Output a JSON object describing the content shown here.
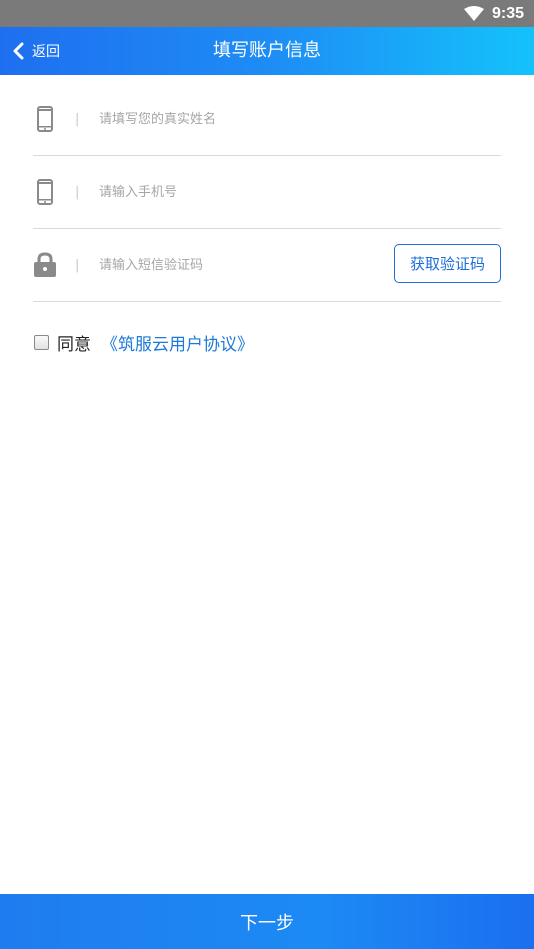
{
  "status_bar": {
    "time": "9:35",
    "wifi_icon": "wifi-icon"
  },
  "nav": {
    "back_label": "返回",
    "title": "填写账户信息"
  },
  "form": {
    "name": {
      "placeholder": "请填写您的真实姓名",
      "icon": "phone-icon"
    },
    "phone": {
      "placeholder": "请输入手机号",
      "icon": "phone-icon"
    },
    "sms_code": {
      "placeholder": "请输入短信验证码",
      "icon": "lock-icon",
      "button_label": "获取验证码"
    }
  },
  "agreement": {
    "text": "同意",
    "link": "《筑服云用户协议》"
  },
  "footer": {
    "next_label": "下一步"
  },
  "colors": {
    "primary": "#1e7cf0",
    "link": "#1d7ad8",
    "status_bar": "#7a7a7a"
  }
}
